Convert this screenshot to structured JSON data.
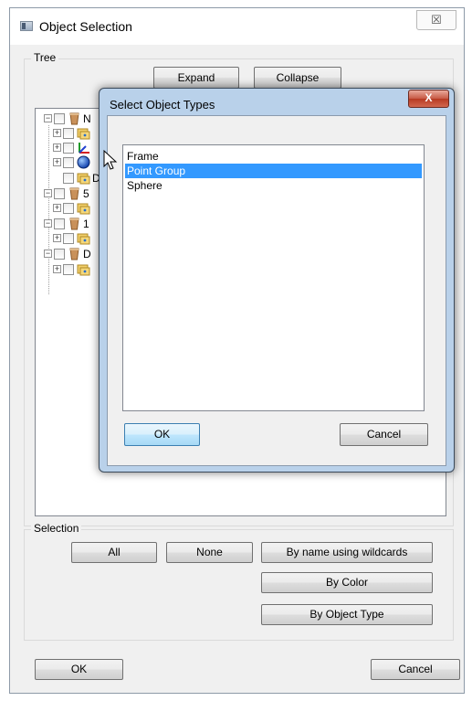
{
  "window": {
    "title": "Object Selection",
    "close_glyph": "☒"
  },
  "tree_group": {
    "label": "Tree",
    "expand_label": "Expand",
    "collapse_label": "Collapse"
  },
  "tree_items": [
    {
      "icon": "bucket-icon",
      "label": "N"
    },
    {
      "icon": "folder-group-icon",
      "label": ""
    },
    {
      "icon": "frame-axes-icon",
      "label": ""
    },
    {
      "icon": "sphere-icon",
      "label": ""
    },
    {
      "icon": "folder-group-icon",
      "label": "D"
    },
    {
      "icon": "bucket-icon",
      "label": "5"
    },
    {
      "icon": "folder-group-icon",
      "label": ""
    },
    {
      "icon": "bucket-icon",
      "label": "1"
    },
    {
      "icon": "folder-group-icon",
      "label": ""
    },
    {
      "icon": "bucket-icon",
      "label": "D"
    },
    {
      "icon": "folder-group-icon",
      "label": ""
    }
  ],
  "selection_group": {
    "label": "Selection",
    "all_label": "All",
    "none_label": "None",
    "wildcards_label": "By name using wildcards",
    "color_label": "By Color",
    "type_label": "By Object Type"
  },
  "footer": {
    "ok_label": "OK",
    "cancel_label": "Cancel"
  },
  "modal": {
    "title": "Select Object Types",
    "close_glyph": "X",
    "options": [
      "Frame",
      "Point Group",
      "Sphere"
    ],
    "selected": "Point Group",
    "ok_label": "OK",
    "cancel_label": "Cancel"
  },
  "colors": {
    "selection": "#3399ff",
    "modal_frame": "#b9d1ea",
    "close_red": "#c75a45"
  }
}
